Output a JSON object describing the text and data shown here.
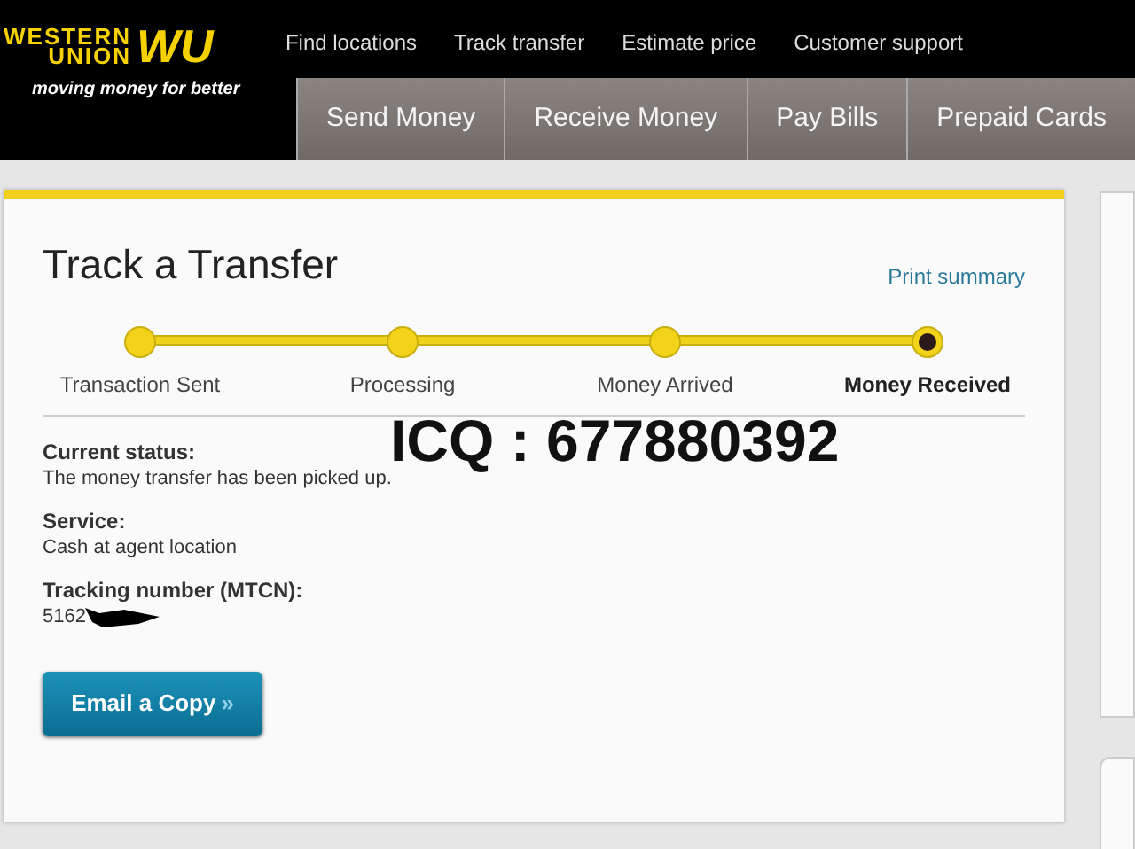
{
  "logo": {
    "wordmark_top": "WESTERN",
    "wordmark_bottom": "UNION",
    "monogram": "WU",
    "tagline": "moving money for better"
  },
  "top_links": [
    "Find locations",
    "Track transfer",
    "Estimate price",
    "Customer support"
  ],
  "tabs": [
    {
      "label": "Send Money",
      "selected": false
    },
    {
      "label": "Receive Money",
      "selected": false
    },
    {
      "label": "Pay Bills",
      "selected": false
    },
    {
      "label": "Prepaid Cards",
      "selected": false
    }
  ],
  "card": {
    "title": "Track a Transfer",
    "print_link": "Print summary",
    "steps": [
      {
        "label": "Transaction Sent",
        "current": false
      },
      {
        "label": "Processing",
        "current": false
      },
      {
        "label": "Money Arrived",
        "current": false
      },
      {
        "label": "Money Received",
        "current": true
      }
    ],
    "details": [
      {
        "label": "Current status:",
        "value": "The money transfer has been picked up.",
        "redacted": false
      },
      {
        "label": "Service:",
        "value": "Cash at agent location",
        "redacted": false
      },
      {
        "label": "Tracking number (MTCN):",
        "value": "5162",
        "redacted": true
      }
    ],
    "button": {
      "label": "Email a Copy",
      "arrow": "»"
    }
  },
  "overlay_text": "ICQ : 677880392"
}
